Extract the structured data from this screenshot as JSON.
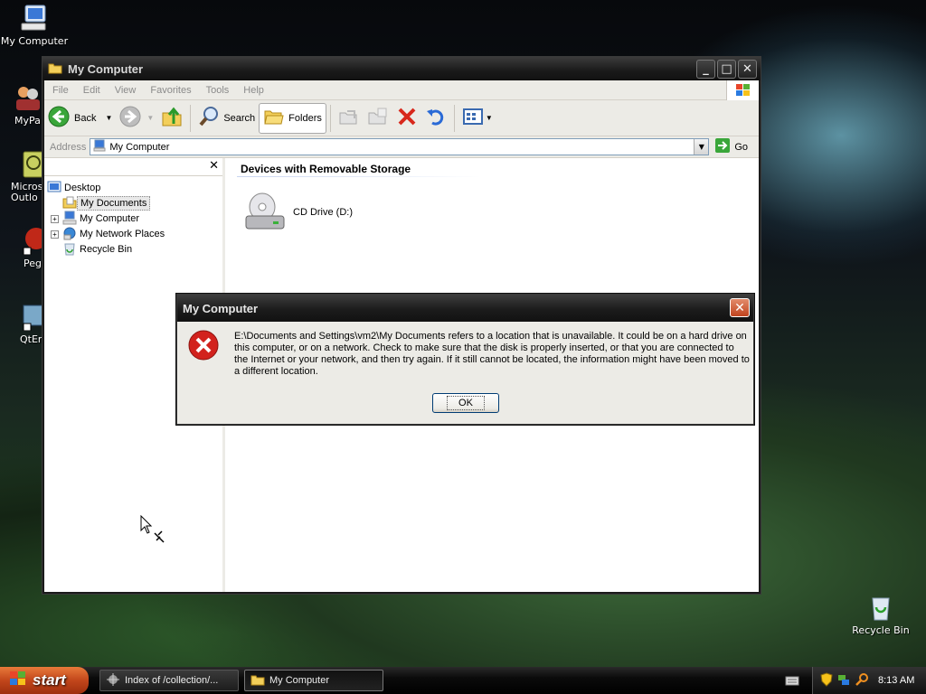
{
  "desktop": {
    "icons": [
      {
        "label": "My Computer"
      },
      {
        "label": "MyPa"
      },
      {
        "label": "Micros Outlo"
      },
      {
        "label": "Peg"
      },
      {
        "label": "QtEr"
      },
      {
        "label": "Recycle Bin"
      }
    ]
  },
  "window": {
    "title": "My Computer",
    "menu": [
      "File",
      "Edit",
      "View",
      "Favorites",
      "Tools",
      "Help"
    ],
    "toolbar": {
      "back_label": "Back",
      "search_label": "Search",
      "folders_label": "Folders"
    },
    "address": {
      "label": "Address",
      "value": "My Computer",
      "go_label": "Go"
    },
    "folders_pane": {
      "items": [
        {
          "label": "Desktop",
          "selected": false,
          "expandable": false
        },
        {
          "label": "My Documents",
          "selected": true,
          "expandable": false
        },
        {
          "label": "My Computer",
          "selected": false,
          "expandable": true
        },
        {
          "label": "My Network Places",
          "selected": false,
          "expandable": true
        },
        {
          "label": "Recycle Bin",
          "selected": false,
          "expandable": false
        }
      ]
    },
    "main": {
      "group_header": "Devices with Removable Storage",
      "drive_label": "CD Drive (D:)"
    }
  },
  "dialog": {
    "title": "My Computer",
    "message": "E:\\Documents and Settings\\vm2\\My Documents refers to a location that is unavailable. It could be on a hard drive on this computer, or on a network. Check to make sure that the disk is properly inserted, or that you are connected to the Internet or your network, and then try again. If it still cannot be located, the information might have been moved to a different location.",
    "ok_label": "OK"
  },
  "taskbar": {
    "start_label": "start",
    "tasks": [
      {
        "label": "Index of /collection/..."
      },
      {
        "label": "My Computer"
      }
    ],
    "clock": "8:13 AM"
  },
  "colors": {
    "start_button": "#c2461b",
    "dialog_bg": "#ecebe6",
    "error_red": "#d2221d"
  }
}
